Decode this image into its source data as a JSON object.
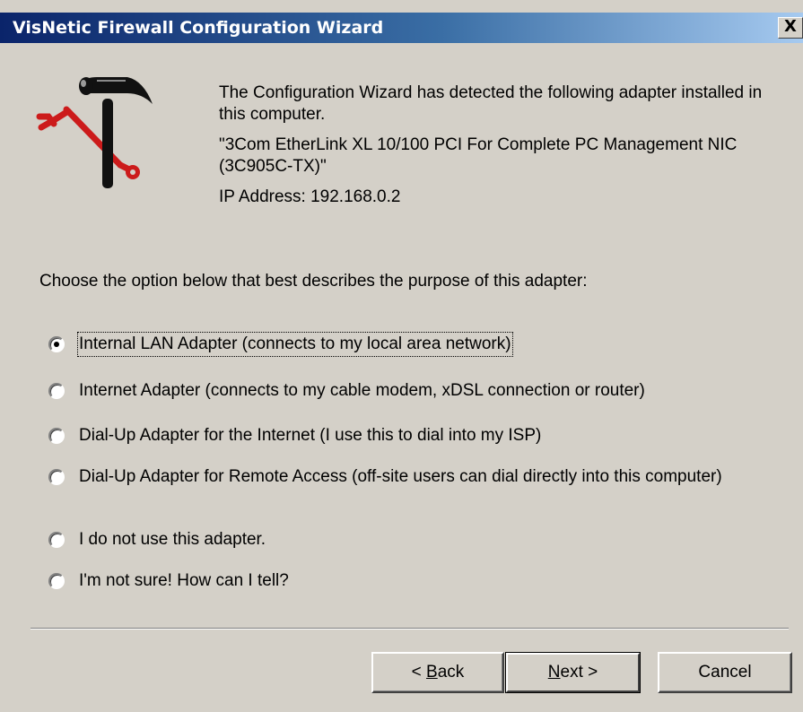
{
  "window": {
    "title": "VisNetic Firewall Configuration Wizard",
    "close_glyph": "X"
  },
  "intro": {
    "line1": "The Configuration Wizard has detected the following adapter installed in this computer.",
    "adapter": "\"3Com EtherLink XL 10/100 PCI For Complete PC Management NIC (3C905C-TX)\"",
    "ip": "IP Address: 192.168.0.2"
  },
  "prompt": "Choose the option below that best describes the purpose of this adapter:",
  "options": [
    {
      "label": "Internal LAN Adapter (connects to my local area network)",
      "checked": true
    },
    {
      "label": "Internet Adapter (connects to my cable modem, xDSL connection or router)",
      "checked": false
    },
    {
      "label": "Dial-Up Adapter for the Internet (I use this to dial into my ISP)",
      "checked": false
    },
    {
      "label": "Dial-Up Adapter for Remote Access (off-site users can dial directly into this computer)",
      "checked": false
    },
    {
      "label": "I do not use this adapter.",
      "checked": false
    },
    {
      "label": "I'm not sure! How can I tell?",
      "checked": false
    }
  ],
  "buttons": {
    "back": {
      "prefix": "< ",
      "mnemonic": "B",
      "rest": "ack"
    },
    "next": {
      "mnemonic": "N",
      "rest": "ext >"
    },
    "cancel": "Cancel"
  },
  "icon": "wizard-hammer-wrench-icon",
  "colors": {
    "titlebar_start": "#0a246a",
    "titlebar_end": "#a6caf0",
    "dialog_bg": "#d4d0c8",
    "wrench": "#cc1b1b"
  }
}
